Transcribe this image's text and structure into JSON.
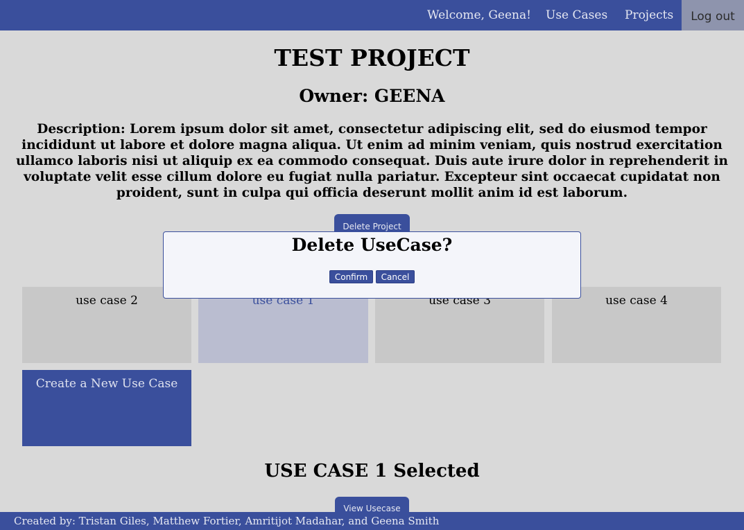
{
  "nav": {
    "welcome": "Welcome, Geena!",
    "use_cases": "Use Cases",
    "projects": "Projects",
    "logout": "Log out"
  },
  "project": {
    "title": "TEST PROJECT",
    "owner": "Owner: GEENA",
    "description": "Description: Lorem ipsum dolor sit amet, consectetur adipiscing elit, sed do eiusmod tempor incididunt ut labore et dolore magna aliqua. Ut enim ad minim veniam, quis nostrud exercitation ullamco laboris nisi ut aliquip ex ea commodo consequat. Duis aute irure dolor in reprehenderit in voluptate velit esse cillum dolore eu fugiat nulla pariatur. Excepteur sint occaecat cupidatat non proident, sunt in culpa qui officia deserunt mollit anim id est laborum.",
    "delete_button": "Delete Project"
  },
  "use_cases": [
    {
      "label": "use case 2",
      "selected": false
    },
    {
      "label": "use case 1",
      "selected": true
    },
    {
      "label": "use case 3",
      "selected": false
    },
    {
      "label": "use case 4",
      "selected": false
    }
  ],
  "create_new": "Create a New Use Case",
  "selection": {
    "heading": "USE CASE 1 Selected",
    "view_button": "View Usecase"
  },
  "footer": "Created by: Tristan Giles, Matthew Fortier, Amritijot Madahar, and Geena Smith",
  "modal": {
    "title": "Delete UseCase?",
    "confirm": "Confirm",
    "cancel": "Cancel"
  },
  "colors": {
    "brand": "#3a4f9c",
    "background": "#d9d9d9",
    "card": "#c8c8c8",
    "card_selected": "#babdd0"
  }
}
